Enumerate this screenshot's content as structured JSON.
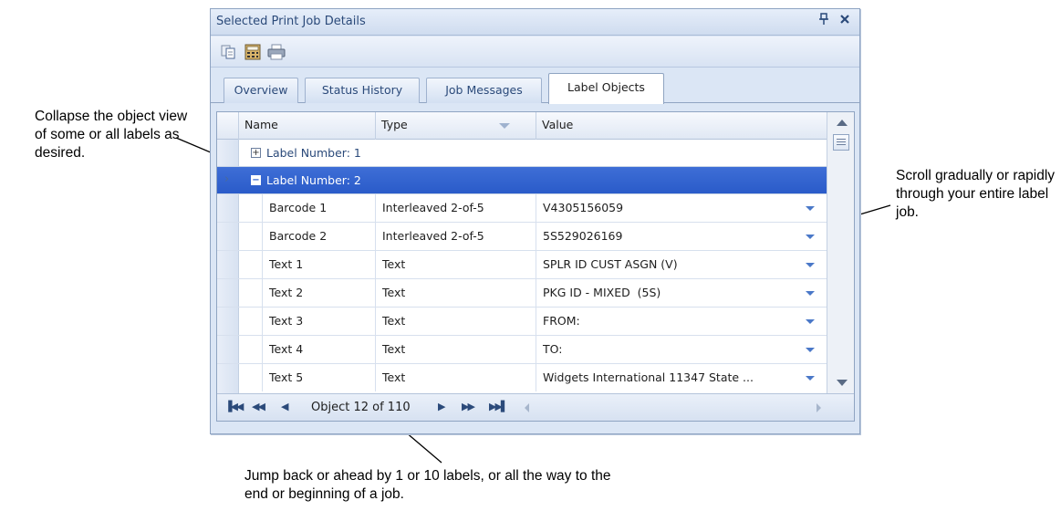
{
  "callouts": {
    "left": "Collapse the object view of some or all labels as desired.",
    "right": "Scroll gradually or rapidly through your entire label job.",
    "bottom": "Jump back or ahead by 1 or 10 labels, or all the way to the end or beginning of a job."
  },
  "window": {
    "title": "Selected Print Job Details",
    "pin_icon": "pin-icon",
    "close_icon": "close-icon"
  },
  "toolbar": {
    "buttons": [
      "copy-icon",
      "calculator-icon",
      "printer-icon"
    ]
  },
  "tabs": [
    {
      "label": "Overview",
      "active": false
    },
    {
      "label": "Status History",
      "active": false
    },
    {
      "label": "Job Messages",
      "active": false
    },
    {
      "label": "Label Objects",
      "active": true
    }
  ],
  "grid": {
    "columns": [
      "Name",
      "Type",
      "Value"
    ],
    "groups": [
      {
        "label": "Label Number: 1",
        "expanded": false,
        "expander": "+"
      },
      {
        "label": "Label Number: 2",
        "expanded": true,
        "expander": "−",
        "selected": true
      }
    ],
    "rows": [
      {
        "name": "Barcode 1",
        "type": "Interleaved 2-of-5",
        "value": "V4305156059"
      },
      {
        "name": "Barcode 2",
        "type": "Interleaved 2-of-5",
        "value": "5S529026169"
      },
      {
        "name": "Text 1",
        "type": "Text",
        "value": "SPLR ID CUST ASGN (V)"
      },
      {
        "name": "Text 2",
        "type": "Text",
        "value": "PKG ID - MIXED  (5S)"
      },
      {
        "name": "Text 3",
        "type": "Text",
        "value": "FROM:"
      },
      {
        "name": "Text 4",
        "type": "Text",
        "value": "TO:"
      },
      {
        "name": "Text 5",
        "type": "Text",
        "value": "Widgets International 11347 State ..."
      }
    ],
    "row_indicator": "›"
  },
  "navigator": {
    "first": "⏮",
    "prev10": "◀◀",
    "prev": "◀",
    "status": "Object 12 of 110",
    "next": "▶",
    "next10": "▶▶",
    "last": "⏭"
  },
  "colors": {
    "selection": "#2a5bc9",
    "panel_bg": "#dbe6f5",
    "title_text": "#2b4a7a"
  }
}
